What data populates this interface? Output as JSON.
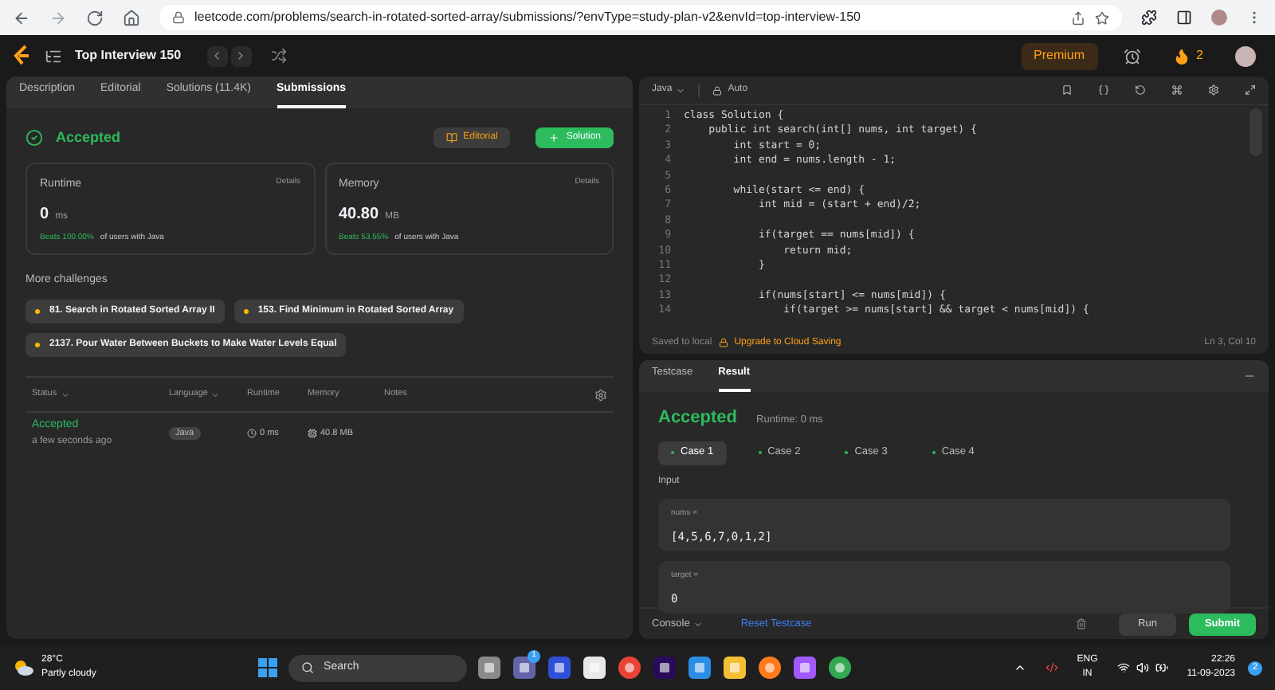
{
  "browser": {
    "url": "leetcode.com/problems/search-in-rotated-sorted-array/submissions/?envType=study-plan-v2&envId=top-interview-150"
  },
  "header": {
    "title": "Top Interview 150",
    "premium": "Premium",
    "streak": "2"
  },
  "left_tabs": [
    {
      "label": "Description",
      "selected": false
    },
    {
      "label": "Editorial",
      "selected": false
    },
    {
      "label": "Solutions (11.4K)",
      "selected": false
    },
    {
      "label": "Submissions",
      "selected": true
    }
  ],
  "result": {
    "status": "Accepted",
    "editorial_button": "Editorial",
    "solution_button": "Solution"
  },
  "stats": [
    {
      "title": "Runtime",
      "details": "Details",
      "value": "0",
      "unit": "ms",
      "beats": "Beats 100.00%",
      "suffix": "of users with Java"
    },
    {
      "title": "Memory",
      "details": "Details",
      "value": "40.80",
      "unit": "MB",
      "beats": "Beats 53.55%",
      "suffix": "of users with Java"
    }
  ],
  "more_challenges": {
    "title": "More challenges",
    "items": [
      "81. Search in Rotated Sorted Array II",
      "153. Find Minimum in Rotated Sorted Array",
      "2137. Pour Water Between Buckets to Make Water Levels Equal"
    ]
  },
  "submissions_table": {
    "columns": [
      "Status",
      "Language",
      "Runtime",
      "Memory",
      "Notes"
    ],
    "rows": [
      {
        "status": "Accepted",
        "time": "a few seconds ago",
        "language": "Java",
        "runtime": "0 ms",
        "memory": "40.8 MB"
      }
    ]
  },
  "editor": {
    "language": "Java",
    "mode": "Auto",
    "lines": [
      {
        "number": "1",
        "code": "class Solution {"
      },
      {
        "number": "2",
        "code": "    public int search(int[] nums, int target) {"
      },
      {
        "number": "3",
        "code": "        int start = 0;"
      },
      {
        "number": "4",
        "code": "        int end = nums.length - 1;"
      },
      {
        "number": "5"
      },
      {
        "number": "6",
        "code": "        while(start <= end) {"
      },
      {
        "number": "7",
        "code": "            int mid = (start + end)/2;"
      },
      {
        "number": "8"
      },
      {
        "number": "9",
        "code": "            if(target == nums[mid]) {"
      },
      {
        "number": "10",
        "code": "                return mid;"
      },
      {
        "number": "11",
        "code": "            }"
      },
      {
        "number": "12"
      },
      {
        "number": "13",
        "code": "            if(nums[start] <= nums[mid]) {"
      },
      {
        "number": "14",
        "code": "                if(target >= nums[start] && target < nums[mid]) {"
      }
    ],
    "saved": "Saved to local",
    "upgrade": "Upgrade to Cloud Saving",
    "cursor": "Ln 3, Col 10"
  },
  "console": {
    "tabs": [
      {
        "label": "Testcase",
        "selected": false
      },
      {
        "label": "Result",
        "selected": true
      }
    ],
    "status": "Accepted",
    "runtime": "Runtime: 0 ms",
    "cases": [
      {
        "label": "Case 1",
        "selected": true
      },
      {
        "label": "Case 2",
        "selected": false
      },
      {
        "label": "Case 3",
        "selected": false
      },
      {
        "label": "Case 4",
        "selected": false
      }
    ],
    "input_label": "Input",
    "inputs": [
      {
        "name": "nums =",
        "value": "[4,5,6,7,0,1,2]"
      },
      {
        "name": "target =",
        "value": "0"
      }
    ],
    "console_button": "Console",
    "reset": "Reset Testcase",
    "run": "Run",
    "submit": "Submit"
  },
  "taskbar": {
    "temperature": "28°C",
    "weather": "Partly cloudy",
    "search": "Search",
    "chat_badge": "1",
    "language": "ENG",
    "region": "IN",
    "time": "22:26",
    "date": "11-09-2023",
    "notification_count": "2"
  }
}
